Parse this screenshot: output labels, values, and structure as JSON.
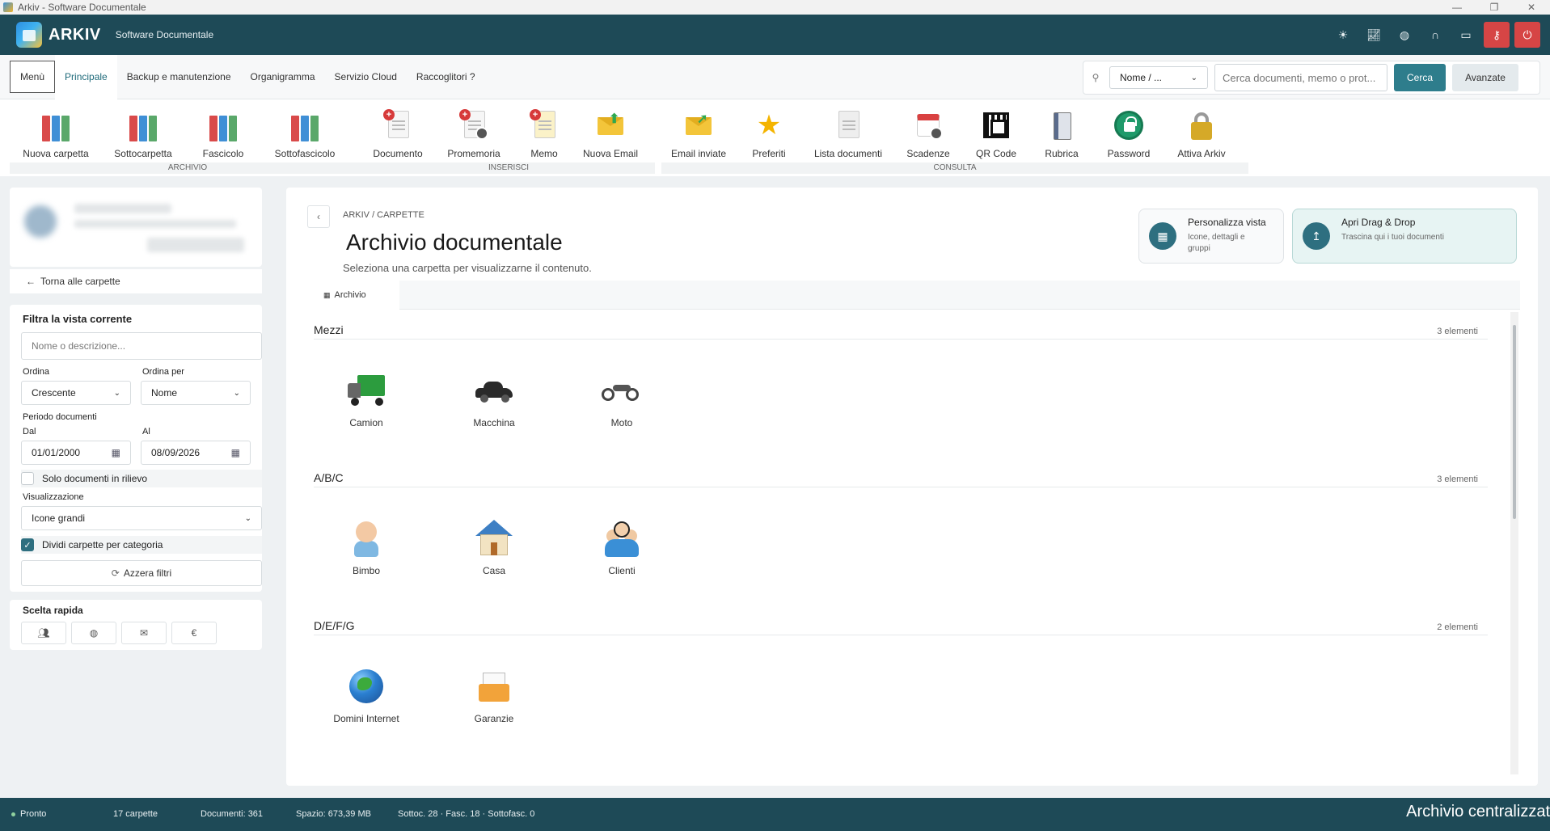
{
  "os_window": {
    "title": "Arkiv - Software Documentale",
    "controls": [
      "—",
      "❐",
      "✕"
    ]
  },
  "header": {
    "brand": "ARKIV",
    "subtitle": "Software Documentale",
    "icons": [
      "sun-icon",
      "chart-icon",
      "globe-icon",
      "headset-icon",
      "chat-icon",
      "key-icon",
      "power-icon"
    ]
  },
  "tabs": {
    "menu": "Menù",
    "items": [
      "Principale",
      "Backup e manutenzione",
      "Organigramma",
      "Servizio Cloud",
      "Raccoglitori ?"
    ],
    "active": "Principale"
  },
  "search": {
    "scope_value": "Nome / ...",
    "placeholder": "Cerca documenti, memo o prot...",
    "search_label": "Cerca",
    "advanced_label": "Avanzate"
  },
  "toolbar": {
    "groups": {
      "archivio": "ARCHIVIO",
      "inserisci": "INSERISCI",
      "consulta": "CONSULTA"
    },
    "tools": {
      "nuova_carpetta": "Nuova carpetta",
      "sottocarpetta": "Sottocarpetta",
      "fascicolo": "Fascicolo",
      "sottofascicolo": "Sottofascicolo",
      "documento": "Documento",
      "promemoria": "Promemoria",
      "memo": "Memo",
      "nuova_email": "Nuova Email",
      "email_inviate": "Email inviate",
      "preferiti": "Preferiti",
      "lista_documenti": "Lista documenti",
      "scadenze": "Scadenze",
      "qr_code": "QR Code",
      "rubrica": "Rubrica",
      "password": "Password",
      "attiva_arkiv": "Attiva Arkiv"
    }
  },
  "sidebar": {
    "back_label": "Torna alle carpette",
    "filter": {
      "title": "Filtra la vista corrente",
      "name_placeholder": "Nome o descrizione...",
      "order_label": "Ordina",
      "order_value": "Crescente",
      "order_by_label": "Ordina per",
      "order_by_value": "Nome",
      "period_label": "Periodo documenti",
      "from_label": "Dal",
      "from_value": "01/01/2000",
      "to_label": "Al",
      "to_value": "08/09/2026",
      "highlight_only_label": "Solo documenti in rilievo",
      "highlight_only_checked": false,
      "view_label": "Visualizzazione",
      "view_value": "Icone grandi",
      "split_by_category_label": "Dividi carpette per categoria",
      "split_by_category_checked": true,
      "reset_label": "Azzera filtri"
    },
    "quick_pick": {
      "title": "Scelta rapida",
      "buttons": [
        "users-icon",
        "globe-icon",
        "mail-icon",
        "euro-icon"
      ],
      "euro_glyph": "€"
    }
  },
  "main": {
    "breadcrumb": "ARKIV  /  CARPETTE",
    "title": "Archivio documentale",
    "subtitle": "Seleziona una carpetta per visualizzarne il contenuto.",
    "cards": {
      "customize": {
        "title": "Personalizza vista",
        "subtitle": "Icone, dettagli e gruppi"
      },
      "dragdrop": {
        "title": "Apri Drag & Drop",
        "subtitle": "Trascina qui i tuoi documenti"
      }
    },
    "view_tab": "Archivio",
    "sections": [
      {
        "title": "Mezzi",
        "count": "3 elementi",
        "folders": [
          "Camion",
          "Macchina",
          "Moto"
        ]
      },
      {
        "title": "A/B/C",
        "count": "3 elementi",
        "folders": [
          "Bimbo",
          "Casa",
          "Clienti"
        ]
      },
      {
        "title": "D/E/F/G",
        "count": "2 elementi",
        "folders": [
          "Domini Internet",
          "Garanzie"
        ]
      }
    ]
  },
  "statusbar": {
    "status": "Pronto",
    "folders": "17 carpette",
    "documents": "Documenti: 361",
    "space": "Spazio: 673,39 MB",
    "counts": "Sottoc. 28  ·  Fasc. 18  ·  Sottofasc. 0",
    "marquee": "Archivio centralizzat"
  },
  "colors": {
    "header_bg": "#1e4a57",
    "accent": "#2e7d8c",
    "danger": "#d64545"
  }
}
